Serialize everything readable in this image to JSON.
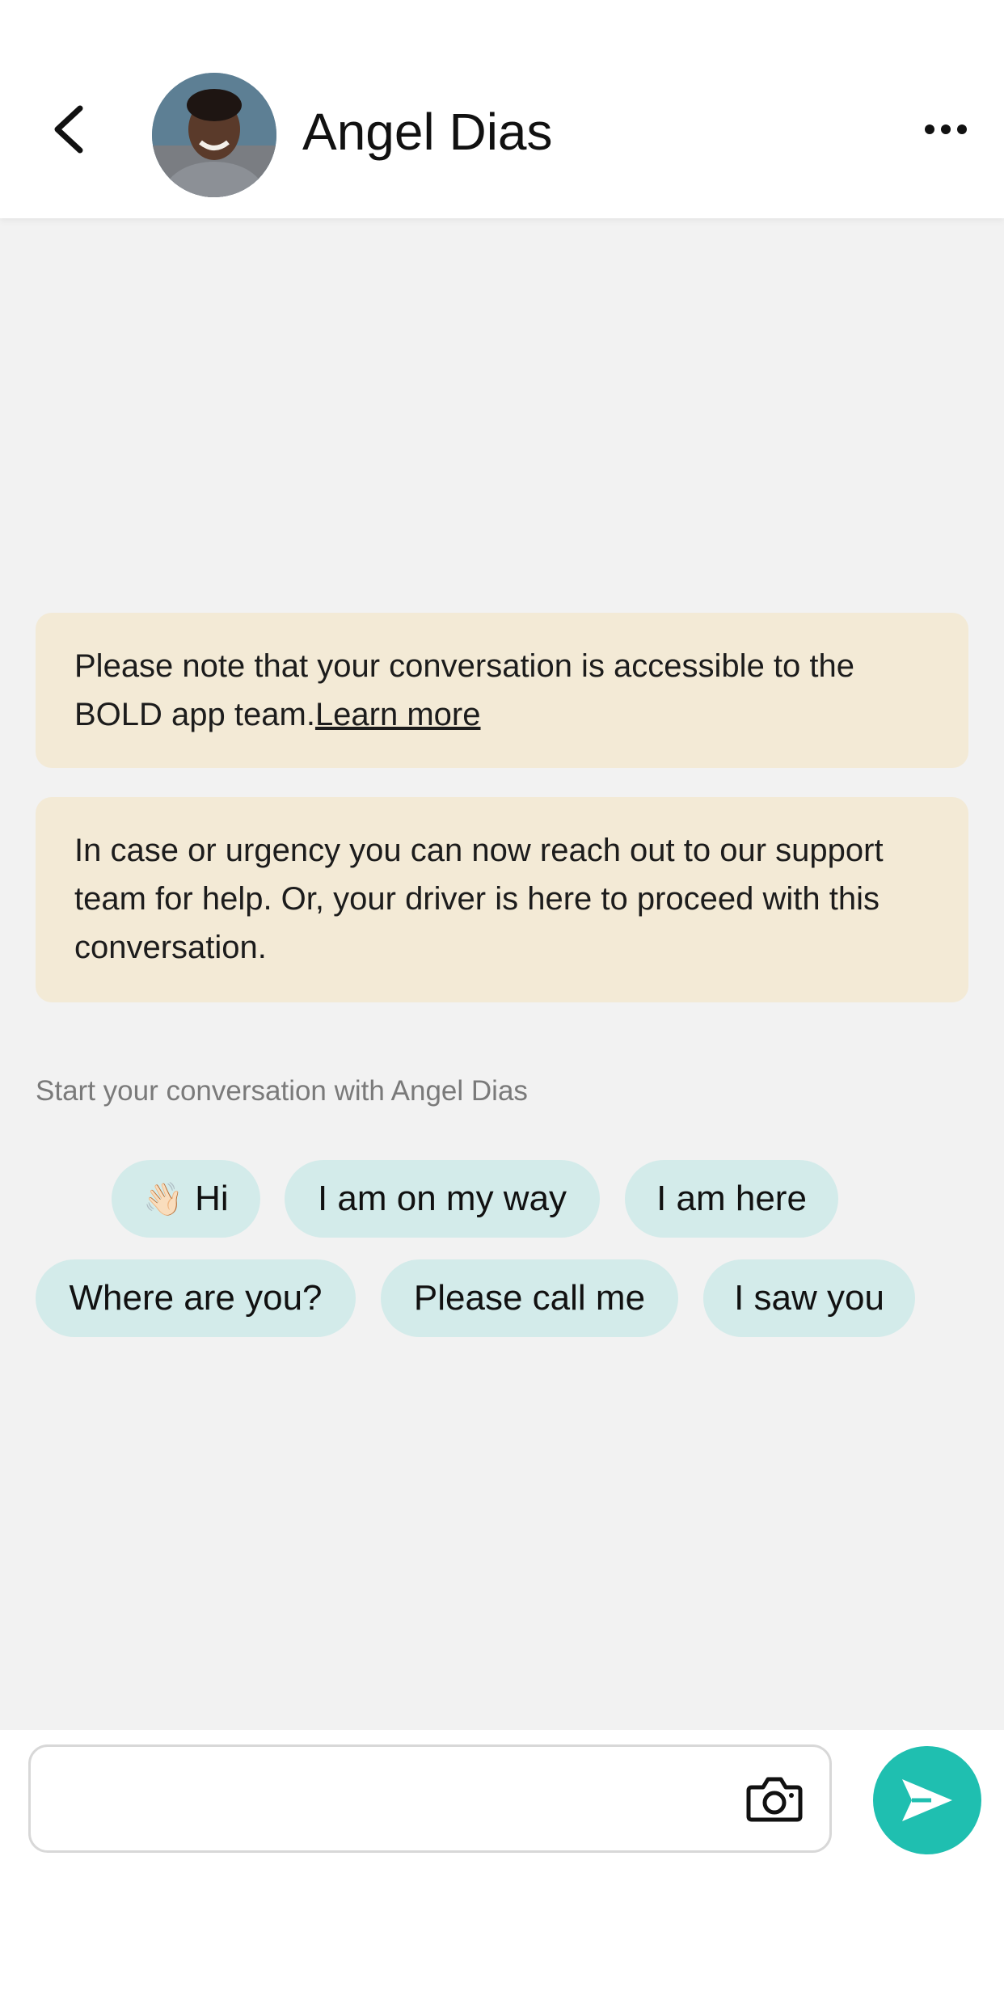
{
  "header": {
    "back_icon": "chevron-left-icon",
    "contact_name": "Angel Dias",
    "avatar": "contact-avatar",
    "more_icon": "more-horizontal-icon"
  },
  "notices": [
    {
      "text": "Please note that your conversation is accessible to the BOLD app team.",
      "link_label": "Learn more"
    },
    {
      "text": "In case or urgency you can now reach out to our support team for help. Or, your driver is here to proceed with this conversation."
    }
  ],
  "quick_replies": {
    "label": "Start your conversation with Angel Dias",
    "chips": [
      {
        "emoji": "👋🏻",
        "text": "Hi"
      },
      {
        "text": "I am on my way"
      },
      {
        "text": "I am here"
      },
      {
        "text": "Where are you?"
      },
      {
        "text": "Please call me"
      },
      {
        "text": "I saw you"
      }
    ]
  },
  "composer": {
    "placeholder": "",
    "camera_icon": "camera-icon",
    "send_icon": "send-icon"
  },
  "colors": {
    "notice_bg": "#f3ead6",
    "chip_bg": "#d3ebea",
    "send_button": "#1fbfb0",
    "chat_bg": "#f2f2f2"
  }
}
